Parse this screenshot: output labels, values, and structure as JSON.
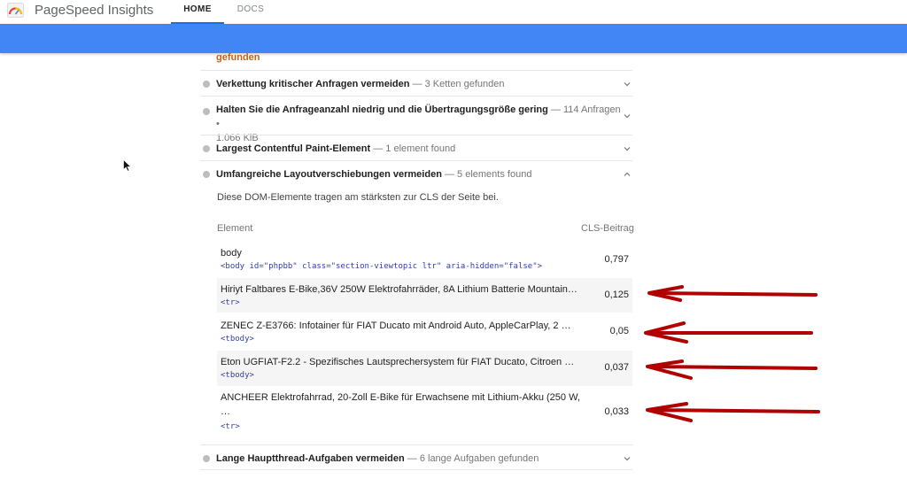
{
  "header": {
    "brand": "PageSpeed Insights",
    "tabs": [
      {
        "label": "HOME",
        "active": true
      },
      {
        "label": "DOCS",
        "active": false
      }
    ]
  },
  "colors": {
    "accent_blue": "#4285f4",
    "warning_orange": "#c5621a",
    "annotation_red": "#b00000"
  },
  "partial_found": "gefunden",
  "audits": [
    {
      "title": "Verkettung kritischer Anfragen vermeiden",
      "sub": "— 3 Ketten gefunden",
      "expanded": false
    },
    {
      "title": "Halten Sie die Anfrageanzahl niedrig und die Übertragungsgröße gering",
      "sub": "— 114 Anfragen •",
      "sub2": "1.066 KiB",
      "expanded": false
    },
    {
      "title": "Largest Contentful Paint-Element",
      "sub": "— 1 element found",
      "expanded": false
    },
    {
      "title": "Umfangreiche Layoutverschiebungen vermeiden",
      "sub": "— 5 elements found",
      "expanded": true
    },
    {
      "title": "Lange Hauptthread-Aufgaben vermeiden",
      "sub": "— 6 lange Aufgaben gefunden",
      "expanded": false
    }
  ],
  "cls_section": {
    "description": "Diese DOM-Elemente tragen am stärksten zur CLS der Seite bei.",
    "col_element": "Element",
    "col_cls": "CLS-Beitrag",
    "rows": [
      {
        "text": "body",
        "code": "<body id=\"phpbb\" class=\"section-viewtopic ltr\" aria-hidden=\"false\">",
        "value": "0,797"
      },
      {
        "text": "Hiriyt Faltbares E-Bike,36V 250W Elektrofahrräder, 8A Lithium Batterie Mountain…",
        "code": "<tr>",
        "value": "0,125"
      },
      {
        "text": " ZENEC Z-E3766: Infotainer für FIAT Ducato mit Android Auto, AppleCarPlay, 2 …",
        "code": "<tbody>",
        "value": "0,05"
      },
      {
        "text": " Eton UGFIAT-F2.2 - Spezifisches Lautsprechersystem für FIAT Ducato, Citroen …",
        "code": "<tbody>",
        "value": "0,037"
      },
      {
        "text": "ANCHEER Elektrofahrrad, 20-Zoll E-Bike für Erwachsene mit Lithium-Akku (250 W,",
        "text2": "…",
        "code": "<tr>",
        "value": "0,033"
      }
    ]
  },
  "icons": {
    "logo": "pagespeed-gauge-icon",
    "chevron_down": "chevron-down-icon",
    "chevron_up": "chevron-up-icon",
    "cursor": "mouse-cursor-icon",
    "arrow": "red-arrow-annotation"
  }
}
